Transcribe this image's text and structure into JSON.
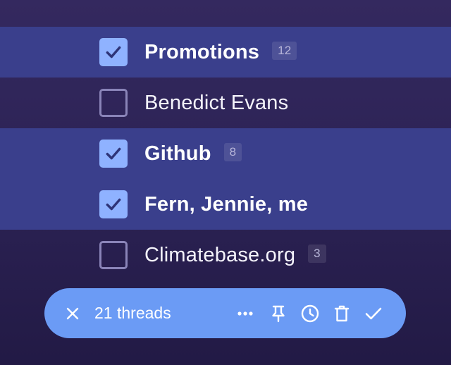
{
  "threads": [
    {
      "sender": "Promotions",
      "count": "12",
      "selected": true,
      "unread": true
    },
    {
      "sender": "Benedict Evans",
      "count": "",
      "selected": false,
      "unread": false
    },
    {
      "sender": "Github",
      "count": "8",
      "selected": true,
      "unread": true
    },
    {
      "sender": "Fern, Jennie, me",
      "count": "",
      "selected": true,
      "unread": true
    },
    {
      "sender": "Climatebase.org",
      "count": "3",
      "selected": false,
      "unread": false
    }
  ],
  "action_bar": {
    "selection_count": "21 threads",
    "icons": [
      "close-icon",
      "more-icon",
      "pin-icon",
      "snooze-clock-icon",
      "trash-icon",
      "checkmark-icon"
    ]
  },
  "colors": {
    "background": "#2d2356",
    "selected_row": "#3a3f8c",
    "checkbox_checked": "#8fb2ff",
    "checkmark": "#2e3478",
    "checkbox_border": "#8a84b8",
    "action_bar": "#6b9bf5"
  }
}
